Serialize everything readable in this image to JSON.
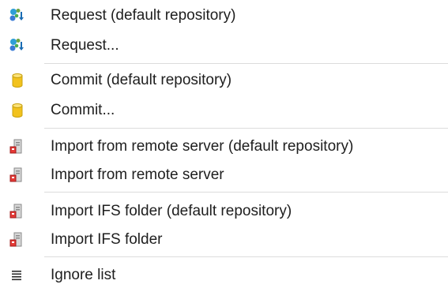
{
  "menu": {
    "items": [
      {
        "label": "Request (default repository)",
        "icon": "request-icon"
      },
      {
        "label": "Request...",
        "icon": "request-icon"
      },
      {
        "label": "Commit (default repository)",
        "icon": "commit-icon"
      },
      {
        "label": "Commit...",
        "icon": "commit-icon"
      },
      {
        "label": "Import from remote server (default repository)",
        "icon": "import-server-icon"
      },
      {
        "label": "Import from remote server",
        "icon": "import-server-icon"
      },
      {
        "label": "Import IFS folder (default repository)",
        "icon": "import-folder-icon"
      },
      {
        "label": "Import IFS folder",
        "icon": "import-folder-icon"
      },
      {
        "label": "Ignore list",
        "icon": "list-icon"
      }
    ]
  }
}
